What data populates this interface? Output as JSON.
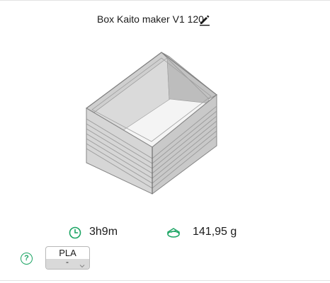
{
  "project": {
    "title": "Box Kaito maker V1 120"
  },
  "stats": {
    "print_time": "3h9m",
    "weight": "141,95 g"
  },
  "filament": {
    "type": "PLA",
    "selection": "-"
  },
  "colors": {
    "accent": "#1aa463",
    "model": "#d8d8d8"
  }
}
